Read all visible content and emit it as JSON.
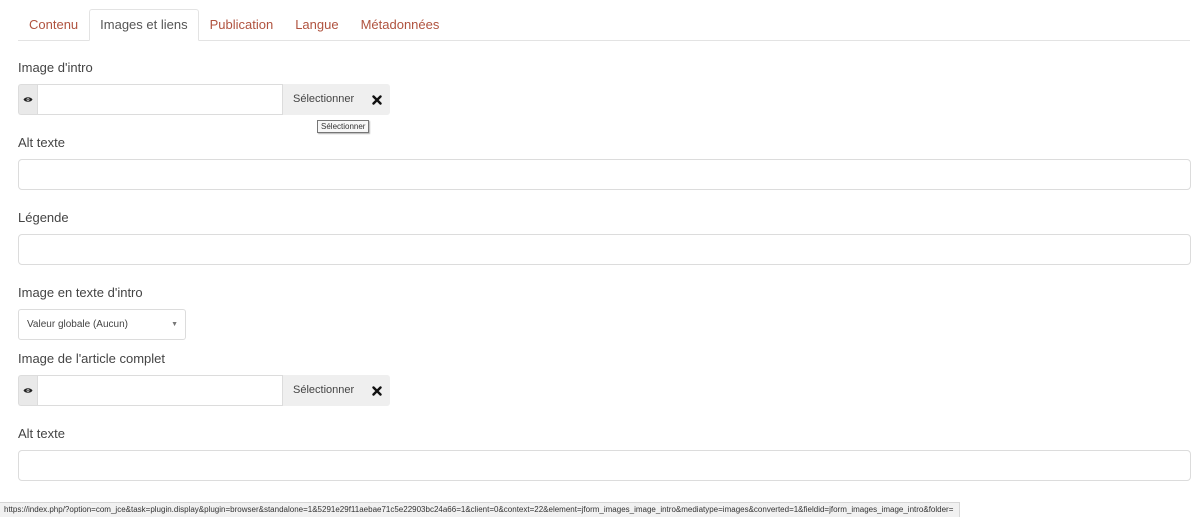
{
  "tabs": [
    {
      "label": "Contenu",
      "active": false
    },
    {
      "label": "Images et liens",
      "active": true
    },
    {
      "label": "Publication",
      "active": false
    },
    {
      "label": "Langue",
      "active": false
    },
    {
      "label": "Métadonnées",
      "active": false
    }
  ],
  "intro_image": {
    "label": "Image d'intro",
    "value": "",
    "select_label": "Sélectionner",
    "tooltip": "Sélectionner",
    "alt_label": "Alt texte",
    "alt_value": "",
    "caption_label": "Légende",
    "caption_value": "",
    "float_label": "Image en texte d'intro",
    "float_value": "Valeur globale (Aucun)"
  },
  "full_image": {
    "label": "Image de l'article complet",
    "value": "",
    "select_label": "Sélectionner",
    "alt_label": "Alt texte",
    "alt_value": ""
  },
  "icons": {
    "preview": "eye-icon",
    "clear": "times-icon",
    "dropdown": "caret-down-icon"
  },
  "colors": {
    "tab_link": "#b0533f",
    "tab_active": "#555555"
  },
  "statusbar": {
    "url": "https://index.php/?option=com_jce&task=plugin.display&plugin=browser&standalone=1&5291e29f11aebae71c5e22903bc24a66=1&client=0&context=22&element=jform_images_image_intro&mediatype=images&converted=1&fieldid=jform_images_image_intro&folder="
  }
}
